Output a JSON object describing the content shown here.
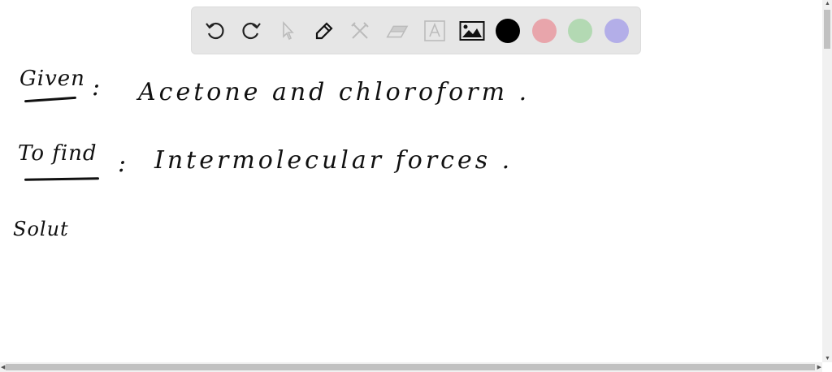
{
  "toolbar": {
    "tools": [
      "undo-icon",
      "redo-icon",
      "select-icon",
      "pen-icon",
      "tools-icon",
      "eraser-icon",
      "text-icon",
      "image-icon"
    ],
    "colors": {
      "black": "#000000",
      "red": "#e8a5ab",
      "green": "#b3d9b3",
      "purple": "#b3aee8"
    }
  },
  "canvas": {
    "line1": {
      "label": "Given",
      "colon": ":",
      "text": "Acetone and chloroform ."
    },
    "line2": {
      "label": "To find",
      "colon": ":",
      "text": "Intermolecular forces ."
    },
    "line3": {
      "text": "Solut"
    }
  }
}
